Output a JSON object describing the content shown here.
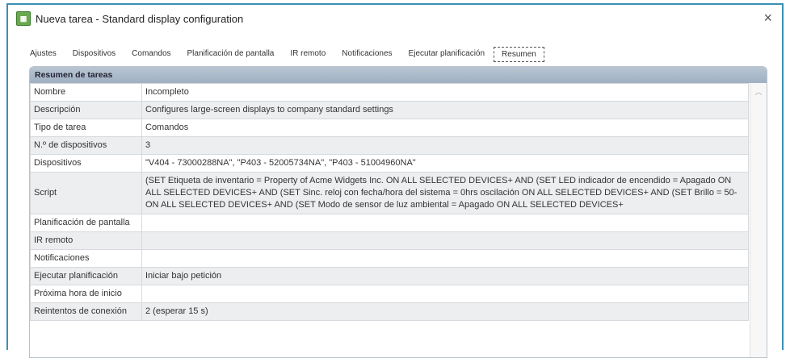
{
  "window": {
    "title": "Nueva tarea - Standard display configuration",
    "close_label": "×"
  },
  "tabs": [
    "Ajustes",
    "Dispositivos",
    "Comandos",
    "Planificación de pantalla",
    "IR remoto",
    "Notificaciones",
    "Ejecutar planificación",
    "Resumen"
  ],
  "active_tab": "Resumen",
  "summary": {
    "header": "Resumen de tareas",
    "rows": [
      {
        "label": "Nombre",
        "value": "Incompleto"
      },
      {
        "label": "Descripción",
        "value": "Configures large-screen displays to company standard settings"
      },
      {
        "label": "Tipo de tarea",
        "value": "Comandos"
      },
      {
        "label": "N.º de dispositivos",
        "value": "3"
      },
      {
        "label": "Dispositivos",
        "value": "\"V404 - 73000288NA\", \"P403 - 52005734NA\", \"P403 - 51004960NA\""
      },
      {
        "label": "Script",
        "value": "(SET Etiqueta de inventario = Property of Acme Widgets Inc. ON ALL SELECTED DEVICES+ AND (SET LED indicador de encendido = Apagado ON ALL SELECTED DEVICES+ AND (SET Sinc. reloj con fecha/hora del sistema = 0hrs oscilación ON ALL SELECTED DEVICES+ AND (SET Brillo = 50- ON ALL SELECTED DEVICES+ AND (SET Modo de sensor de luz ambiental = Apagado ON ALL SELECTED DEVICES+"
      },
      {
        "label": "Planificación de pantalla",
        "value": ""
      },
      {
        "label": "IR remoto",
        "value": ""
      },
      {
        "label": "Notificaciones",
        "value": ""
      },
      {
        "label": "Ejecutar planificación",
        "value": "Iniciar bajo petición"
      },
      {
        "label": "Próxima hora de inicio",
        "value": ""
      },
      {
        "label": "Reintentos de conexión",
        "value": "2 (esperar 15 s)"
      }
    ]
  }
}
